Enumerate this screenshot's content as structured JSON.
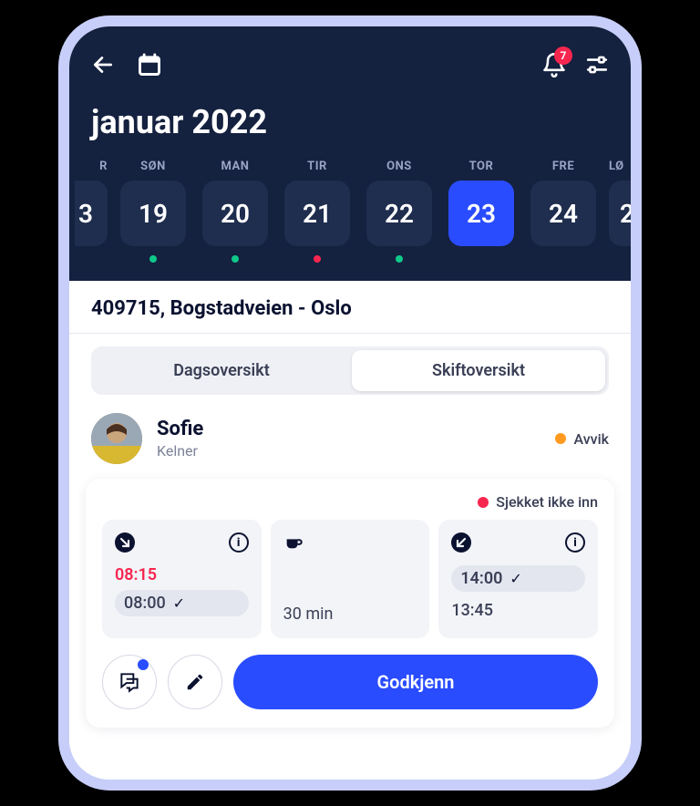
{
  "header": {
    "monthTitle": "januar 2022",
    "notificationCount": "7"
  },
  "week": [
    {
      "weekday": "R",
      "date": "3",
      "edge": "left"
    },
    {
      "weekday": "SØN",
      "date": "19",
      "dot": "green"
    },
    {
      "weekday": "MAN",
      "date": "20",
      "dot": "green"
    },
    {
      "weekday": "TIR",
      "date": "21",
      "dot": "red"
    },
    {
      "weekday": "ONS",
      "date": "22",
      "dot": "green"
    },
    {
      "weekday": "TOR",
      "date": "23",
      "selected": true
    },
    {
      "weekday": "FRE",
      "date": "24"
    },
    {
      "weekday": "LØ",
      "date": "2",
      "edge": "right"
    }
  ],
  "location": "409715, Bogstadveien - Oslo",
  "tabs": {
    "dayOverview": "Dagsoversikt",
    "shiftOverview": "Skiftoversikt"
  },
  "employee": {
    "name": "Sofie",
    "role": "Kelner",
    "deviationLabel": "Avvik"
  },
  "card": {
    "notCheckedIn": "Sjekket ikke inn",
    "checkIn": {
      "actual": "08:15",
      "planned": "08:00"
    },
    "break": {
      "duration": "30 min"
    },
    "checkOut": {
      "actual": "14:00",
      "planned": "13:45"
    },
    "approve": "Godkjenn"
  }
}
